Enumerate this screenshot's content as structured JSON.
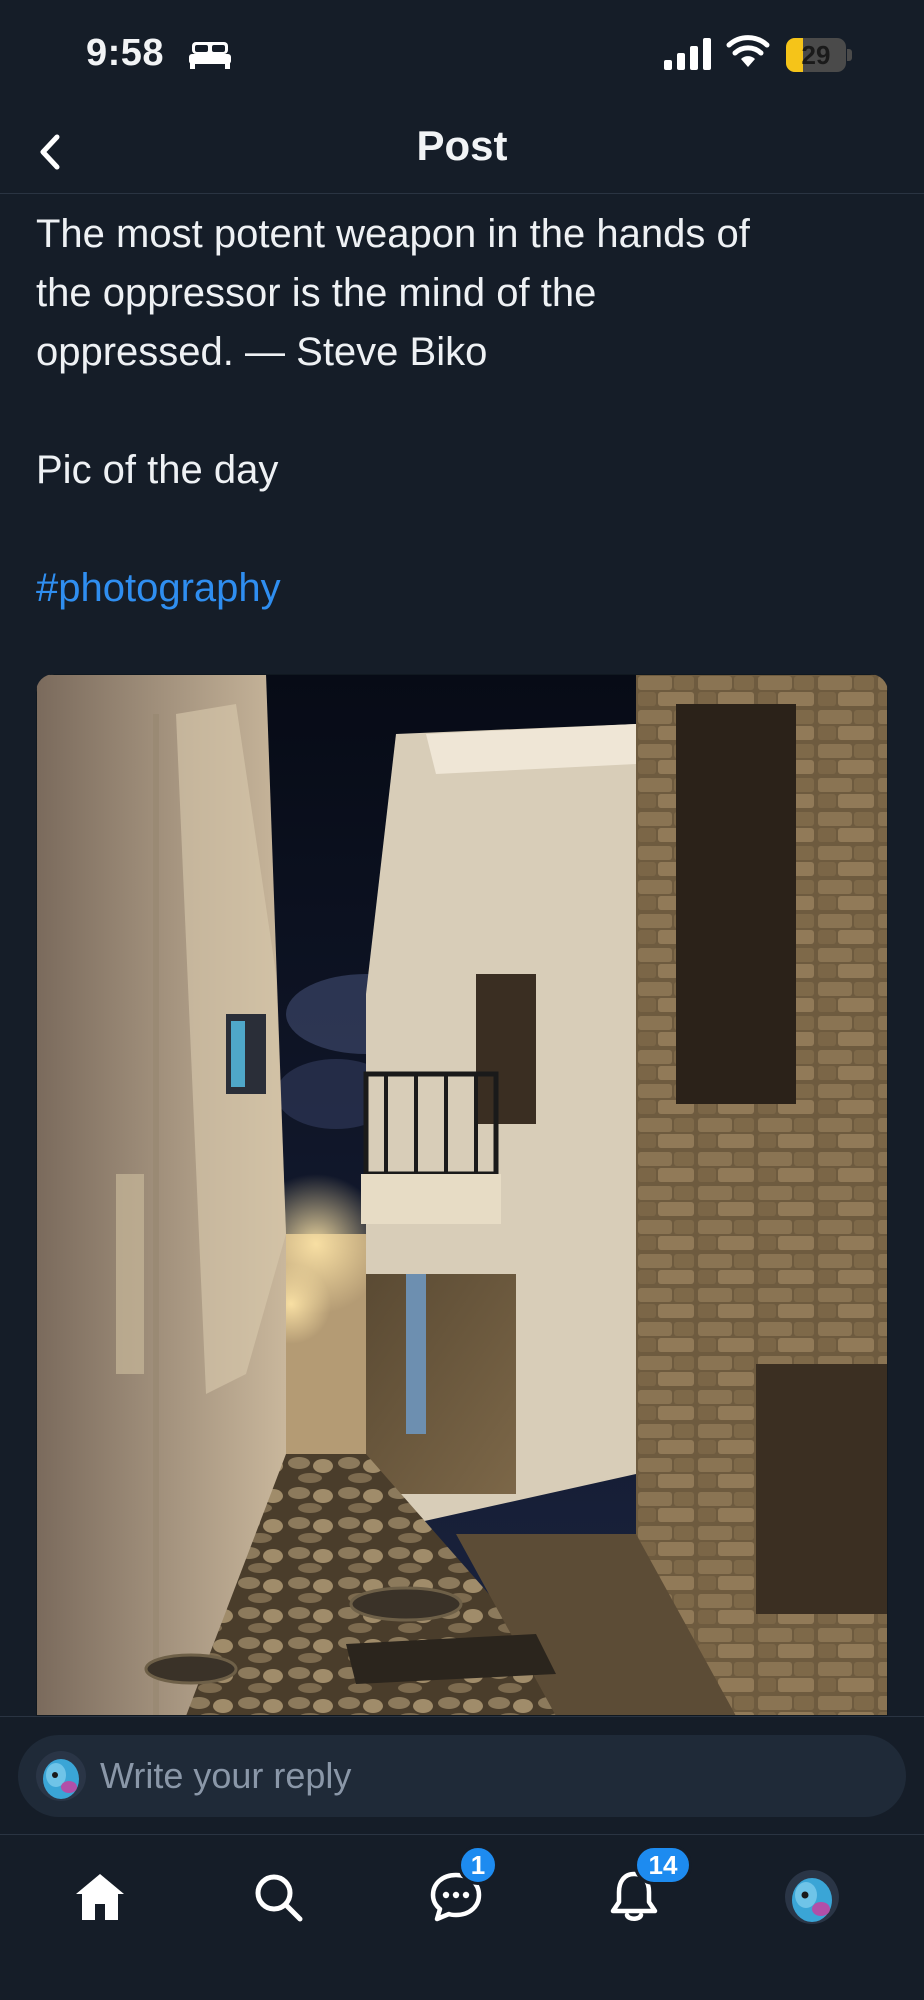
{
  "status_bar": {
    "time": "9:58",
    "battery_level": "29",
    "battery_fraction": 0.29,
    "battery_color": "#f5c419",
    "icons": [
      "bed-icon",
      "signal-icon",
      "wifi-icon",
      "battery-charging-icon"
    ]
  },
  "header": {
    "title": "Post",
    "back_icon": "chevron-left-icon"
  },
  "post": {
    "text_lines": [
      "The  most potent weapon in the hands of",
      "the oppressor is the mind of the",
      "oppressed. — Steve Biko"
    ],
    "caption": "Pic of the day",
    "hashtag": "#photography",
    "hashtag_color": "#2f8ef0",
    "image_subject": "night-alley-photo"
  },
  "reply": {
    "placeholder": "Write your reply"
  },
  "tab_bar": {
    "tabs": [
      {
        "name": "home",
        "icon": "home-icon",
        "active": true
      },
      {
        "name": "search",
        "icon": "search-icon"
      },
      {
        "name": "messages",
        "icon": "chat-bubble-icon",
        "badge": "1"
      },
      {
        "name": "notifications",
        "icon": "bell-icon",
        "badge": "14"
      },
      {
        "name": "profile",
        "icon": "avatar"
      }
    ],
    "badge_color": "#1d8bf0"
  }
}
